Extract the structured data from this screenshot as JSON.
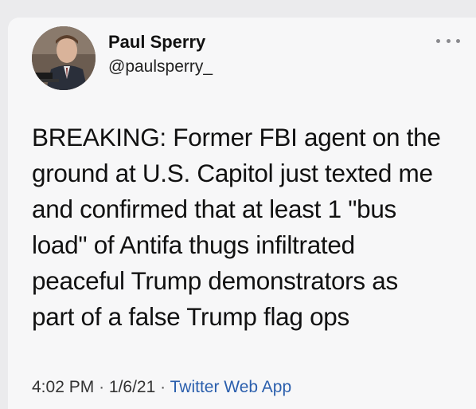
{
  "user": {
    "display_name": "Paul Sperry",
    "handle": "@paulsperry_"
  },
  "tweet": {
    "lines": [
      "BREAKING: Former FBI agent on the",
      "ground at U.S. Capitol just texted me",
      "and confirmed that at least 1 \"bus",
      "load\" of Antifa thugs infiltrated",
      "peaceful Trump demonstrators as",
      "part of a false Trump flag ops"
    ],
    "time": "4:02 PM",
    "date": "1/6/21",
    "source": "Twitter Web App",
    "separator": "·"
  },
  "icons": {
    "more": "more-horizontal-icon"
  },
  "colors": {
    "background": "#ebebed",
    "card": "#f7f7f8",
    "link": "#2b5fad",
    "text": "#111111"
  }
}
